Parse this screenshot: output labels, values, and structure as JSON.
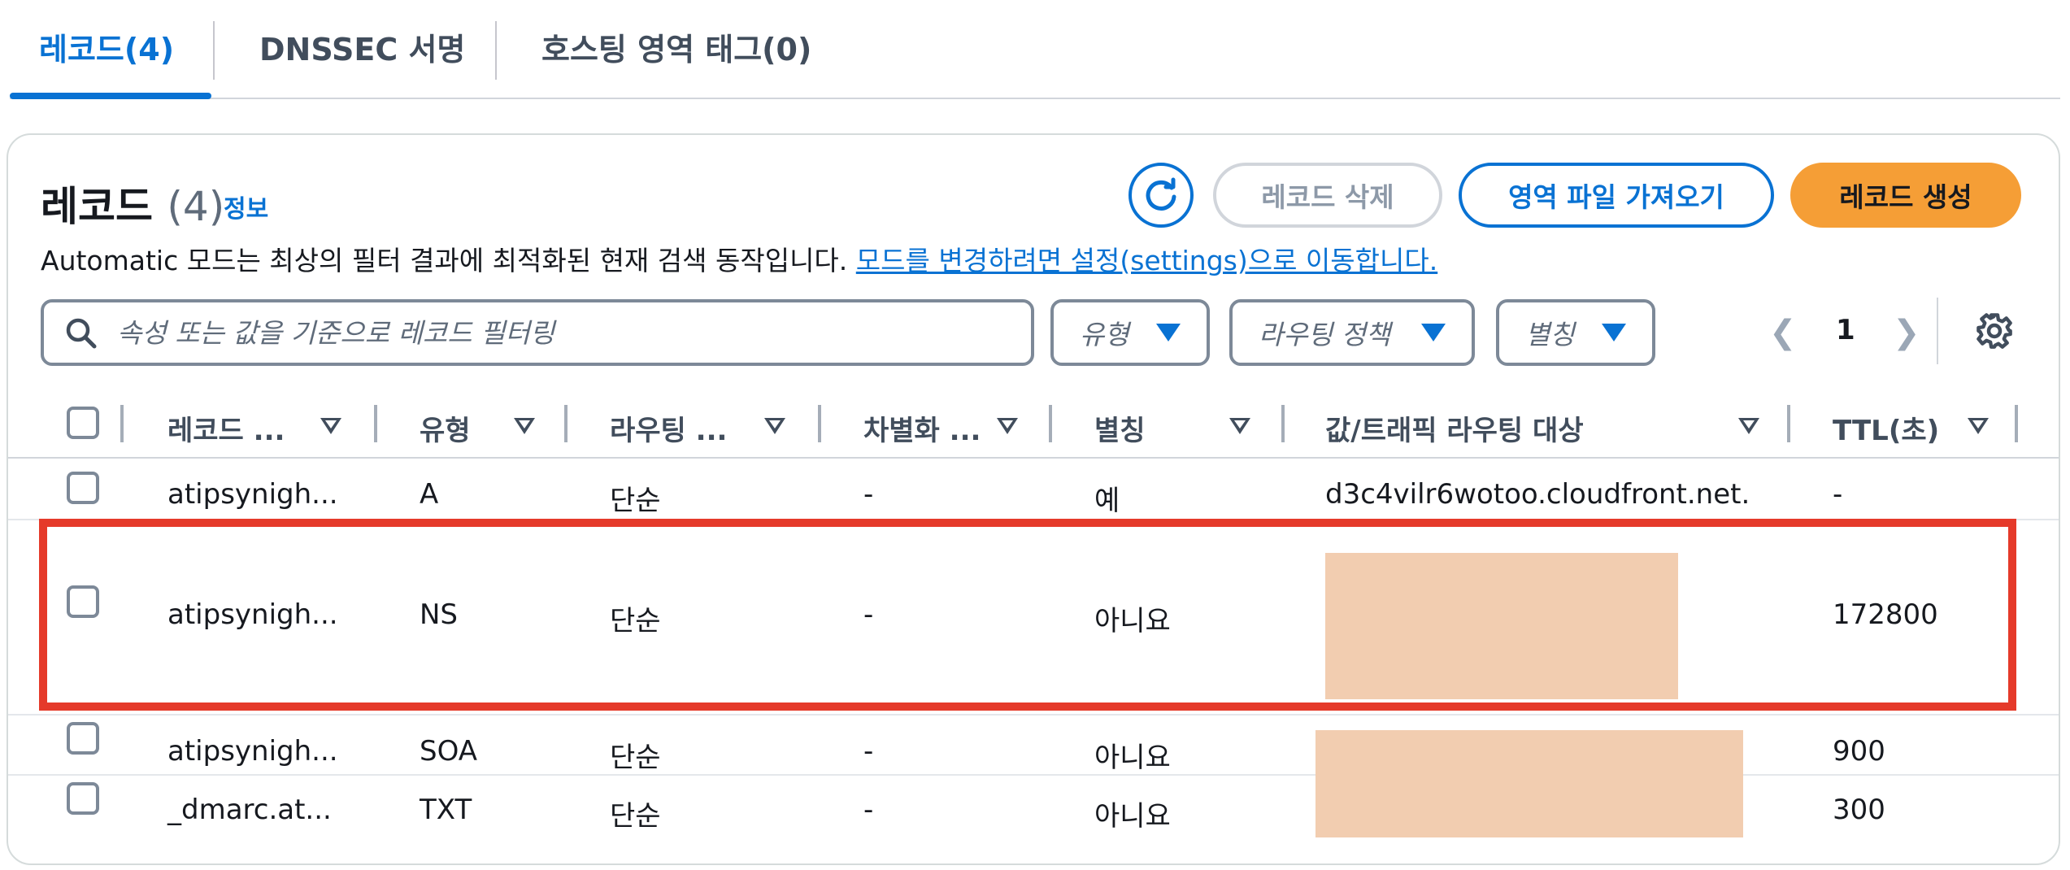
{
  "tabs": [
    {
      "label": "레코드(4)",
      "active": true
    },
    {
      "label": "DNSSEC 서명",
      "active": false
    },
    {
      "label": "호스팅 영역 태그(0)",
      "active": false
    }
  ],
  "panel": {
    "title": "레코드",
    "count": "(4)",
    "info": "정보",
    "description": "Automatic 모드는 최상의 필터 결과에 최적화된 현재 검색 동작입니다. ",
    "description_link": "모드를 변경하려면 설정(settings)으로 이동합니다.",
    "buttons": {
      "delete": "레코드 삭제",
      "import": "영역 파일 가져오기",
      "create": "레코드 생성"
    },
    "search_placeholder": "속성 또는 값을 기준으로 레코드 필터링",
    "filters": [
      "유형",
      "라우팅 정책",
      "별칭"
    ],
    "page": "1"
  },
  "table": {
    "headers": [
      "레코드 ...",
      "유형",
      "라우팅 ...",
      "차별화 ...",
      "별칭",
      "값/트래픽 라우팅 대상",
      "TTL(초)"
    ],
    "rows": [
      {
        "name": "atipsynigh...",
        "type": "A",
        "routing": "단순",
        "diff": "-",
        "alias": "예",
        "value": "d3c4vilr6wotoo.cloudfront.net.",
        "ttl": "-"
      },
      {
        "name": "atipsynigh...",
        "type": "NS",
        "routing": "단순",
        "diff": "-",
        "alias": "아니요",
        "value": "",
        "ttl": "172800"
      },
      {
        "name": "atipsynigh...",
        "type": "SOA",
        "routing": "단순",
        "diff": "-",
        "alias": "아니요",
        "value": "",
        "ttl": "900"
      },
      {
        "name": "_dmarc.at...",
        "type": "TXT",
        "routing": "단순",
        "diff": "-",
        "alias": "아니요",
        "value": "",
        "ttl": "300"
      }
    ]
  },
  "colors": {
    "accent": "#0972d3",
    "primary_button": "#f59e36",
    "highlight": "#e53a2a",
    "redaction": "#f2cdb0"
  }
}
